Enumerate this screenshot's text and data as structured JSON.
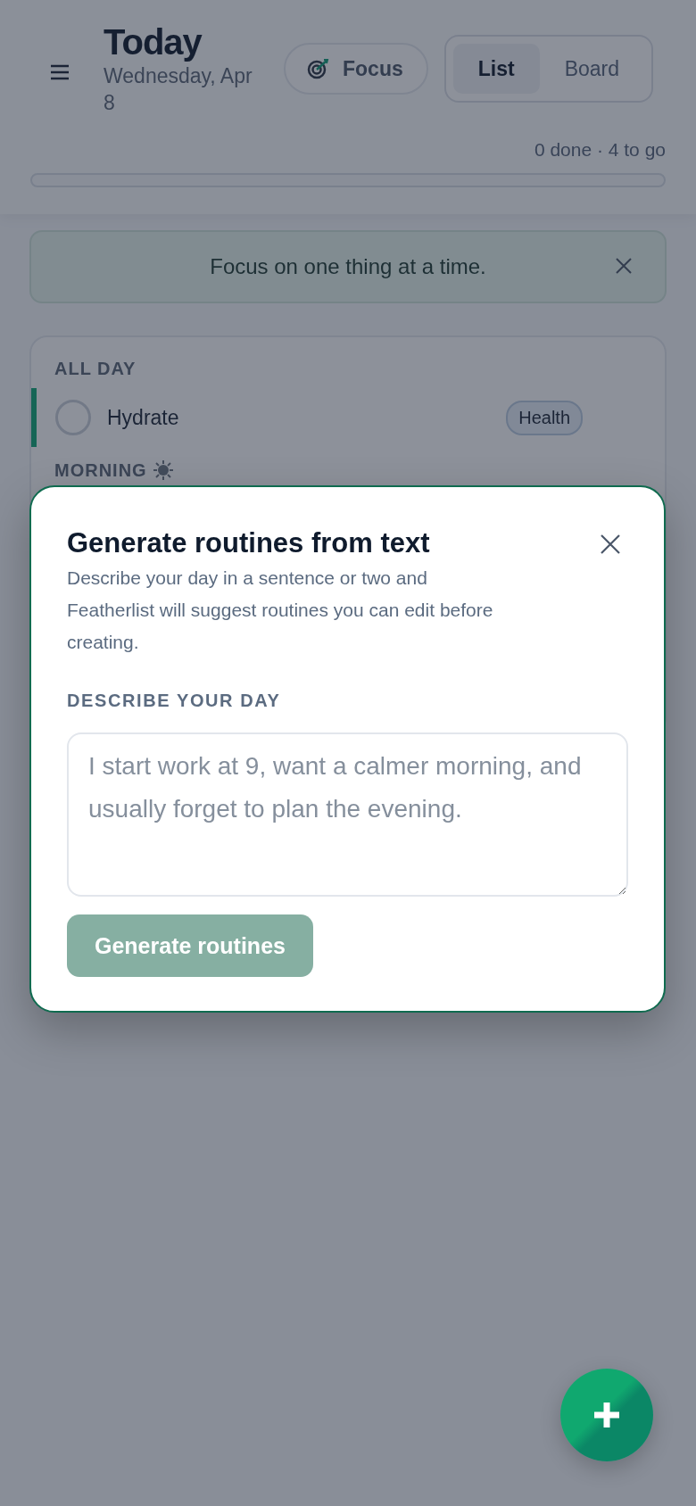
{
  "header": {
    "title": "Today",
    "date": "Wednesday, Apr 8",
    "focus_button": "Focus",
    "view_tabs": [
      {
        "label": "List",
        "selected": true
      },
      {
        "label": "Board",
        "selected": false
      }
    ],
    "progress_text": "0 done · 4 to go",
    "progress": {
      "level": 0
    }
  },
  "banner": {
    "text": "Focus on one thing at a time."
  },
  "sections": [
    {
      "title": "ALL DAY",
      "kind": "plain",
      "tasks": [
        {
          "name": "Hydrate",
          "tag": "Health",
          "checked": false
        }
      ]
    },
    {
      "title": "MORNING",
      "kind": "sun"
    }
  ],
  "dialog": {
    "title": "Generate routines from text",
    "description": "Describe your day in a sentence or two and Featherlist will suggest routines you can edit before creating.",
    "field_label": "DESCRIBE YOUR DAY",
    "placeholder": "I start work at 9, want a calmer morning, and usually forget to plan the evening.",
    "button": {
      "label": "Generate routines",
      "disabled": true
    }
  }
}
